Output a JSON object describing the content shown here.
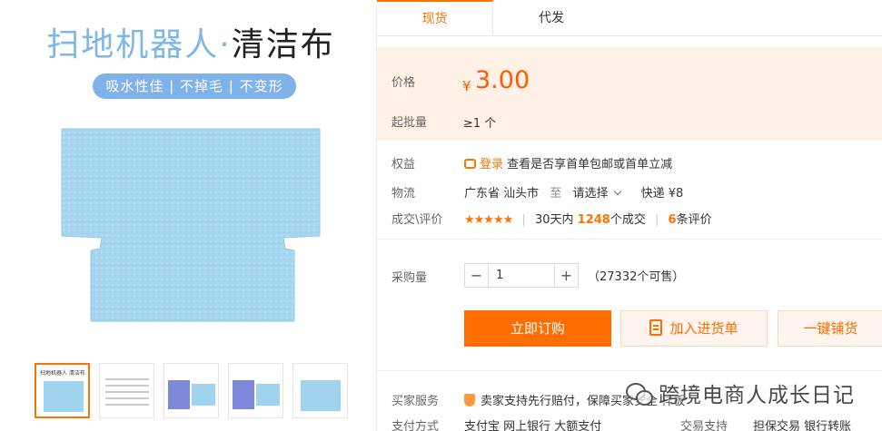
{
  "gallery": {
    "title_a": "扫地机器人·",
    "title_b": "清洁布",
    "tags": "吸水性佳 | 不掉毛 | 不变形",
    "thumb1_title": "扫地机器人 清洁布",
    "cloth_color": "#a6d6ef"
  },
  "tabs": [
    {
      "label": "现货"
    },
    {
      "label": "代发"
    }
  ],
  "price": {
    "label": "价格",
    "currency": "¥",
    "value": "3.00",
    "moq_label": "起批量",
    "moq_value": "≥1 个"
  },
  "benefit": {
    "label": "权益",
    "login": "登录",
    "text": "查看是否享首单包邮或首单立减"
  },
  "logistics": {
    "label": "物流",
    "origin": "广东省 汕头市",
    "to": "至",
    "select": "请选择",
    "express": "快递 ¥8"
  },
  "reviews": {
    "label": "成交\\评价",
    "stars": "★★★★★",
    "days": "30天内",
    "deals": "1248",
    "deals_suffix": "个成交",
    "count": "6",
    "count_suffix": "条评价"
  },
  "purchase": {
    "label": "采购量",
    "minus": "−",
    "quantity": "1",
    "plus": "+",
    "available": "（27332个可售）"
  },
  "actions": {
    "buy": "立即订购",
    "cart": "加入进货单",
    "distribute": "一键铺货"
  },
  "service": {
    "label": "买家服务",
    "text": "卖家支持先行赔付，保障买家",
    "text2": "安全 样板",
    "text3": "退货包邮"
  },
  "payment": {
    "label": "支付方式",
    "methods": "支付宝   网上银行   大额支付",
    "trade_label": "交易支持",
    "trade_values": "担保交易   银行转账"
  },
  "watermark": "跨境电商人成长日记",
  "colors": {
    "accent": "#ff7300",
    "price_bg": "#fff1e6",
    "tag_bg": "#7fb2ea"
  }
}
